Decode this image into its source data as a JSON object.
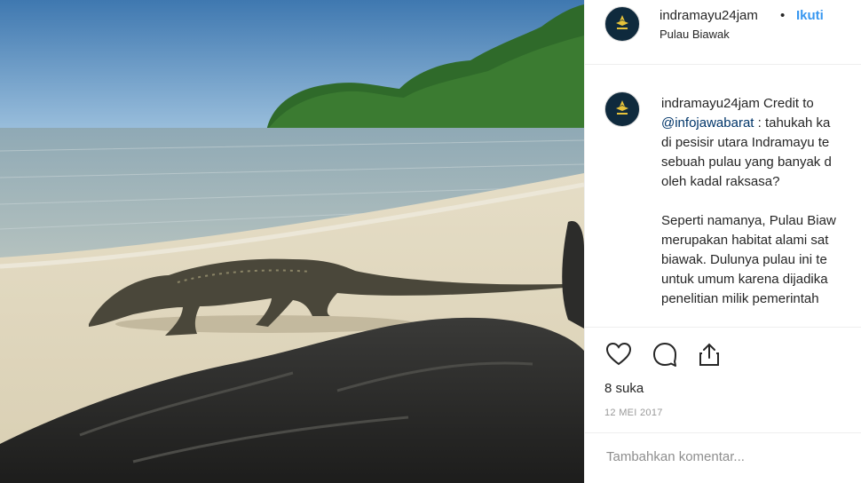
{
  "header": {
    "username": "indramayu24jam",
    "separator": "•",
    "follow_label": "Ikuti",
    "location": "Pulau Biawak"
  },
  "caption": {
    "username": "indramayu24jam",
    "text_start": " Credit to\n",
    "mention": "@infojawabarat",
    "text_rest": " : tahukah ka\ndi pesisir utara Indramayu te\nsebuah pulau yang banyak d\noleh kadal raksasa?\n\nSeperti namanya, Pulau Biaw\nmerupakan habitat alami sat\nbiawak. Dulunya pulau ini te\nuntuk umum karena dijadika\npenelitian milik pemerintah"
  },
  "actions": {
    "like_icon": "heart-icon",
    "comment_icon": "comment-icon",
    "share_icon": "share-icon",
    "likes": "8 suka",
    "date": "12 MEI 2017"
  },
  "comment": {
    "placeholder": "Tambahkan komentar..."
  },
  "colors": {
    "accent": "#3897f0",
    "mention": "#003569",
    "muted": "#999999"
  }
}
